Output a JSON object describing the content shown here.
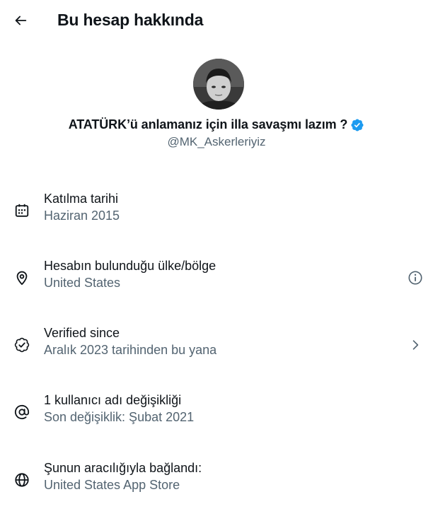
{
  "header": {
    "back_icon": "arrow-left-icon",
    "title": "Bu hesap hakkında"
  },
  "profile": {
    "avatar_icon": "profile-photo",
    "display_name": "ATATÜRK’ü anlamanız için illa savaşmı lazım ?",
    "verified_icon": "verified-badge-icon",
    "verified_color": "#1d9bf0",
    "handle": "@MK_Askerleriyiz"
  },
  "details": [
    {
      "icon": "calendar-icon",
      "title": "Katılma tarihi",
      "value": "Haziran 2015"
    },
    {
      "icon": "location-pin-icon",
      "title": "Hesabın bulunduğu ülke/bölge",
      "value": "United States",
      "end_icon": "info-icon"
    },
    {
      "icon": "verified-check-icon",
      "title": "Verified since",
      "value": "Aralık 2023 tarihinden bu yana",
      "end_icon": "chevron-right-icon"
    },
    {
      "icon": "at-sign-icon",
      "title": "1 kullanıcı adı değişikliği",
      "value": "Son değişiklik: Şubat 2021"
    },
    {
      "icon": "globe-icon",
      "title": "Şunun aracılığıyla bağlandı:",
      "value": "United States App Store"
    }
  ],
  "colors": {
    "text_primary": "#0f1419",
    "text_secondary": "#536471",
    "background": "#ffffff"
  }
}
